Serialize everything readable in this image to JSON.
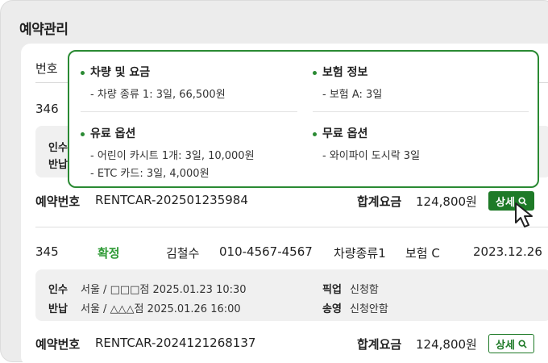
{
  "page": {
    "title": "예약관리"
  },
  "table": {
    "header_first_col": "번호"
  },
  "rows": [
    {
      "number": "346",
      "pickup_label": "인수",
      "return_label": "반납",
      "reservation_label": "예약번호",
      "reservation_no": "RENTCAR-202501235984",
      "total_label": "합계요금",
      "total_value": "124,800원",
      "detail_button": "상세"
    },
    {
      "number": "345",
      "status": "확정",
      "customer": "김철수",
      "phone": "010-4567-4567",
      "car_type": "차량종류1",
      "insurance": "보험 C",
      "date": "2023.12.26",
      "pickup_label": "인수",
      "pickup_value": "서울 / □□□점  2025.01.23  10:30",
      "pickup_service_label": "픽업",
      "pickup_service_value": "신청함",
      "return_label": "반납",
      "return_value": "서울 / △△△점  2025.01.26  16:00",
      "transfer_label": "송영",
      "transfer_value": "신청안함",
      "reservation_label": "예약번호",
      "reservation_no": "RENTCAR-2024121268137",
      "total_label": "합계요금",
      "total_value": "124,800원",
      "detail_button": "상세"
    }
  ],
  "popover": {
    "vehicle": {
      "title": "차량 및 요금",
      "items": [
        "- 차량 종류 1: 3일, 66,500원"
      ]
    },
    "insurance": {
      "title": "보험 정보",
      "items": [
        "- 보험 A: 3일"
      ]
    },
    "paid_options": {
      "title": "유료 옵션",
      "items": [
        "- 어린이 카시트 1개: 3일, 10,000원",
        "- ETC 카드: 3일, 4,000원"
      ]
    },
    "free_options": {
      "title": "무료 옵션",
      "items": [
        "- 와이파이 도시락 3일"
      ]
    }
  },
  "colors": {
    "accent": "#1e7a27",
    "status_confirmed": "#2e9a35",
    "popover_border": "#2a8a33"
  },
  "icons": {
    "detail_button_icon": "search-icon",
    "cursor": "mouse-pointer-icon"
  }
}
